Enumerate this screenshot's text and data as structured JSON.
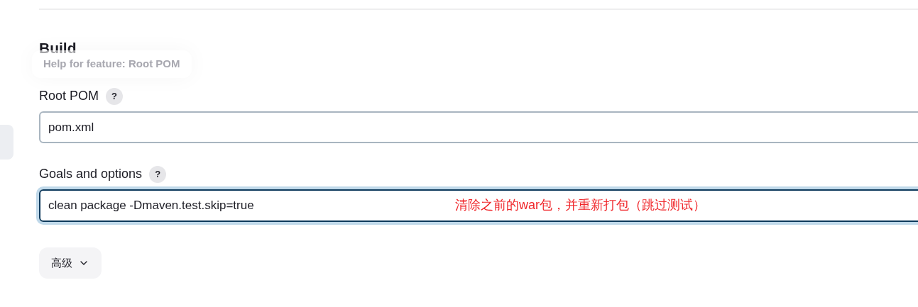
{
  "section": {
    "title": "Build"
  },
  "tooltip": {
    "text": "Help for feature: Root POM"
  },
  "fields": [
    {
      "label": "Root POM",
      "help": "?",
      "value": "pom.xml",
      "focused": false
    },
    {
      "label": "Goals and options",
      "help": "?",
      "value": "clean package -Dmaven.test.skip=true",
      "focused": true,
      "annotation": "清除之前的war包，并重新打包（跳过测试）"
    }
  ],
  "advanced_button": {
    "label": "高级",
    "expanded": false
  }
}
